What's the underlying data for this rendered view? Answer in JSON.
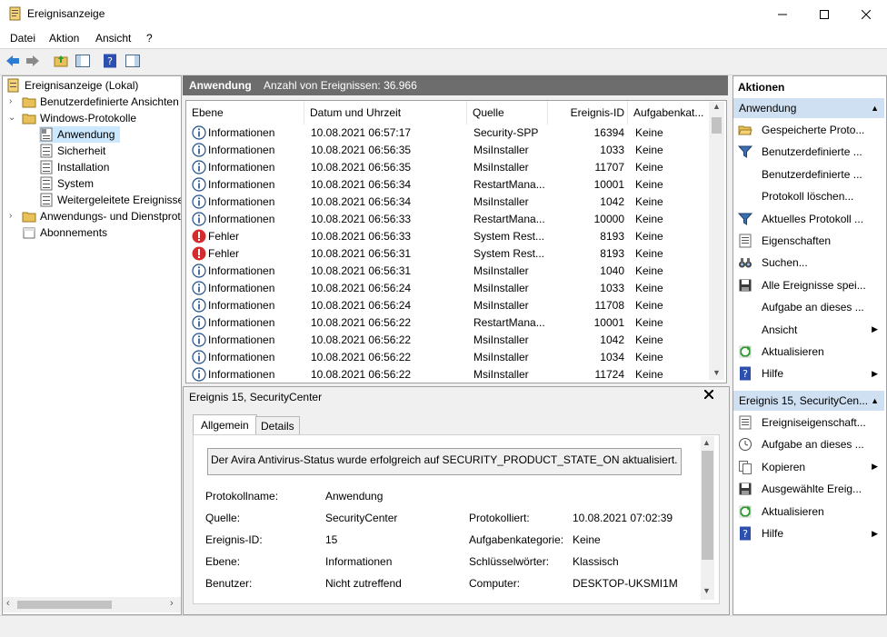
{
  "window": {
    "title": "Ereignisanzeige",
    "minimize": "—",
    "maximize": "☐",
    "close": "✕"
  },
  "menu": [
    "Datei",
    "Aktion",
    "Ansicht",
    "?"
  ],
  "tree": {
    "root": "Ereignisanzeige (Lokal)",
    "custom_views": "Benutzerdefinierte Ansichten",
    "windows_logs": "Windows-Protokolle",
    "logs": [
      "Anwendung",
      "Sicherheit",
      "Installation",
      "System",
      "Weitergeleitete Ereignisse"
    ],
    "app_services": "Anwendungs- und Dienstprotokolle",
    "subscriptions": "Abonnements"
  },
  "center": {
    "log_name": "Anwendung",
    "event_count": "Anzahl von Ereignissen: 36.966",
    "columns": [
      "Ebene",
      "Datum und Uhrzeit",
      "Quelle",
      "Ereignis-ID",
      "Aufgabenkat..."
    ],
    "rows": [
      {
        "level": "Informationen",
        "type": "info",
        "date": "10.08.2021 06:57:17",
        "source": "Security-SPP",
        "id": "16394",
        "task": "Keine"
      },
      {
        "level": "Informationen",
        "type": "info",
        "date": "10.08.2021 06:56:35",
        "source": "MsiInstaller",
        "id": "1033",
        "task": "Keine"
      },
      {
        "level": "Informationen",
        "type": "info",
        "date": "10.08.2021 06:56:35",
        "source": "MsiInstaller",
        "id": "11707",
        "task": "Keine"
      },
      {
        "level": "Informationen",
        "type": "info",
        "date": "10.08.2021 06:56:34",
        "source": "RestartMana...",
        "id": "10001",
        "task": "Keine"
      },
      {
        "level": "Informationen",
        "type": "info",
        "date": "10.08.2021 06:56:34",
        "source": "MsiInstaller",
        "id": "1042",
        "task": "Keine"
      },
      {
        "level": "Informationen",
        "type": "info",
        "date": "10.08.2021 06:56:33",
        "source": "RestartMana...",
        "id": "10000",
        "task": "Keine"
      },
      {
        "level": "Fehler",
        "type": "error",
        "date": "10.08.2021 06:56:33",
        "source": "System Rest...",
        "id": "8193",
        "task": "Keine"
      },
      {
        "level": "Fehler",
        "type": "error",
        "date": "10.08.2021 06:56:31",
        "source": "System Rest...",
        "id": "8193",
        "task": "Keine"
      },
      {
        "level": "Informationen",
        "type": "info",
        "date": "10.08.2021 06:56:31",
        "source": "MsiInstaller",
        "id": "1040",
        "task": "Keine"
      },
      {
        "level": "Informationen",
        "type": "info",
        "date": "10.08.2021 06:56:24",
        "source": "MsiInstaller",
        "id": "1033",
        "task": "Keine"
      },
      {
        "level": "Informationen",
        "type": "info",
        "date": "10.08.2021 06:56:24",
        "source": "MsiInstaller",
        "id": "11708",
        "task": "Keine"
      },
      {
        "level": "Informationen",
        "type": "info",
        "date": "10.08.2021 06:56:22",
        "source": "RestartMana...",
        "id": "10001",
        "task": "Keine"
      },
      {
        "level": "Informationen",
        "type": "info",
        "date": "10.08.2021 06:56:22",
        "source": "MsiInstaller",
        "id": "1042",
        "task": "Keine"
      },
      {
        "level": "Informationen",
        "type": "info",
        "date": "10.08.2021 06:56:22",
        "source": "MsiInstaller",
        "id": "1034",
        "task": "Keine"
      },
      {
        "level": "Informationen",
        "type": "info",
        "date": "10.08.2021 06:56:22",
        "source": "MsiInstaller",
        "id": "11724",
        "task": "Keine"
      }
    ]
  },
  "detail": {
    "title": "Ereignis 15, SecurityCenter",
    "close": "✕",
    "tabs": [
      "Allgemein",
      "Details"
    ],
    "message": "Der Avira Antivirus-Status wurde erfolgreich auf SECURITY_PRODUCT_STATE_ON aktualisiert.",
    "fields": {
      "log_name_label": "Protokollname:",
      "log_name": "Anwendung",
      "source_label": "Quelle:",
      "source": "SecurityCenter",
      "logged_label": "Protokolliert:",
      "logged": "10.08.2021 07:02:39",
      "event_id_label": "Ereignis-ID:",
      "event_id": "15",
      "task_cat_label": "Aufgabenkategorie:",
      "task_cat": "Keine",
      "level_label": "Ebene:",
      "level": "Informationen",
      "keywords_label": "Schlüsselwörter:",
      "keywords": "Klassisch",
      "user_label": "Benutzer:",
      "user": "Nicht zutreffend",
      "computer_label": "Computer:",
      "computer": "DESKTOP-UKSMI1M"
    }
  },
  "actions": {
    "title": "Aktionen",
    "group1": "Anwendung",
    "items1": [
      {
        "label": "Gespeicherte Proto...",
        "icon": "folder-open-icon"
      },
      {
        "label": "Benutzerdefinierte ...",
        "icon": "filter-icon"
      },
      {
        "label": "Benutzerdefinierte ...",
        "icon": ""
      },
      {
        "label": "Protokoll löschen...",
        "icon": ""
      },
      {
        "label": "Aktuelles Protokoll ...",
        "icon": "filter-icon"
      },
      {
        "label": "Eigenschaften",
        "icon": "properties-icon"
      },
      {
        "label": "Suchen...",
        "icon": "binoculars-icon"
      },
      {
        "label": "Alle Ereignisse spei...",
        "icon": "save-icon"
      },
      {
        "label": "Aufgabe an dieses ...",
        "icon": ""
      },
      {
        "label": "Ansicht",
        "icon": "",
        "submenu": true
      },
      {
        "label": "Aktualisieren",
        "icon": "refresh-icon"
      },
      {
        "label": "Hilfe",
        "icon": "help-icon",
        "submenu": true
      }
    ],
    "group2": "Ereignis 15, SecurityCen...",
    "items2": [
      {
        "label": "Ereigniseigenschaft...",
        "icon": "properties-icon"
      },
      {
        "label": "Aufgabe an dieses ...",
        "icon": "task-icon"
      },
      {
        "label": "Kopieren",
        "icon": "copy-icon",
        "submenu": true
      },
      {
        "label": "Ausgewählte Ereig...",
        "icon": "save-icon"
      },
      {
        "label": "Aktualisieren",
        "icon": "refresh-icon"
      },
      {
        "label": "Hilfe",
        "icon": "help-icon",
        "submenu": true
      }
    ]
  }
}
